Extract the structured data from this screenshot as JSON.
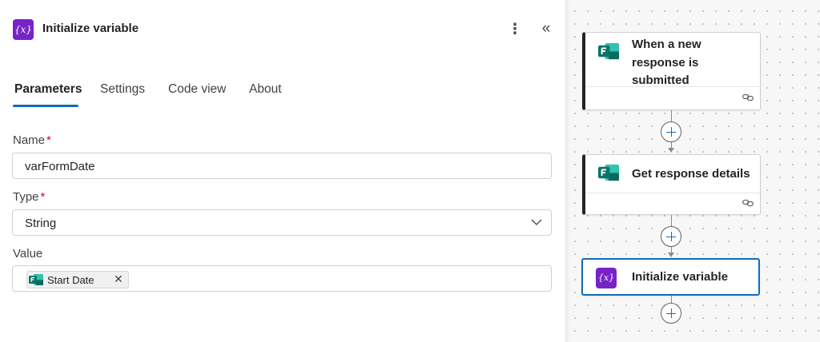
{
  "panel": {
    "title": "Initialize variable",
    "icon": "variable-icon",
    "more_icon": "more-vertical-icon",
    "collapse_icon": "double-chevron-left-icon"
  },
  "tabs": [
    {
      "label": "Parameters",
      "active": true
    },
    {
      "label": "Settings",
      "active": false
    },
    {
      "label": "Code view",
      "active": false
    },
    {
      "label": "About",
      "active": false
    }
  ],
  "fields": {
    "name": {
      "label": "Name",
      "required": "*",
      "value": "varFormDate"
    },
    "type": {
      "label": "Type",
      "required": "*",
      "value": "String"
    },
    "value": {
      "label": "Value",
      "token": "Start Date"
    }
  },
  "flow": {
    "cards": [
      {
        "title": "When a new response is submitted",
        "icon": "forms-icon"
      },
      {
        "title": "Get response details",
        "icon": "forms-icon"
      },
      {
        "title": "Initialize variable",
        "icon": "variable-icon",
        "selected": true
      }
    ]
  },
  "colors": {
    "accent": "#0f6cbd",
    "variable_purple": "#7723c7",
    "forms_teal": "#0b6a5d",
    "required": "#c50f1f"
  }
}
